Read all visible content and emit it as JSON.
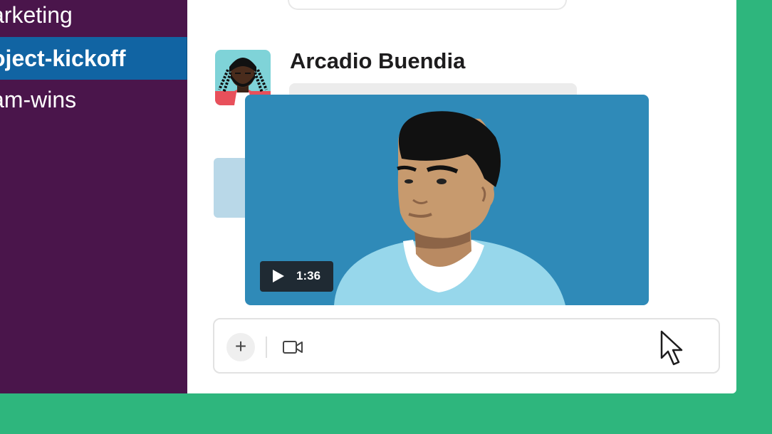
{
  "sidebar": {
    "channels": [
      {
        "label": "arketing",
        "active": false
      },
      {
        "label": "oject-kickoff",
        "active": true
      },
      {
        "label": "am-wins",
        "active": false
      }
    ]
  },
  "message": {
    "author": "Arcadio Buendia",
    "video": {
      "duration": "1:36",
      "play_icon": "play-icon"
    }
  },
  "composer": {
    "plus_label": "+",
    "video_icon": "video-camera-icon"
  },
  "colors": {
    "sidebar_bg": "#4a154b",
    "active_channel": "#1164a3",
    "outer_bg": "#2eb67d",
    "video_bg": "#2f8ab8"
  }
}
